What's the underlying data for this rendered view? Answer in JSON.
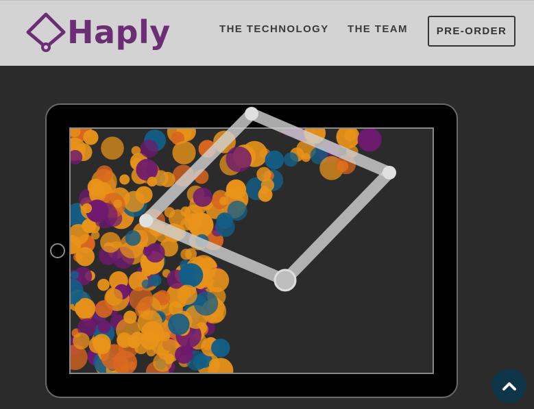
{
  "brand": {
    "name": "Haply",
    "color": "#6b2d73",
    "logo_icon": "diamond-pin-icon"
  },
  "nav": {
    "technology_label": "THE TECHNOLOGY",
    "team_label": "THE TEAM",
    "preorder_label": "PRE-ORDER"
  },
  "scroll_top": {
    "icon": "chevron-up-icon",
    "color": "#0e3548"
  },
  "palette": {
    "orange": "#e8931a",
    "dark_orange": "#d9661f",
    "purple": "#6e1a6f",
    "teal": "#135e86",
    "linkage": "#cfcfcf"
  }
}
